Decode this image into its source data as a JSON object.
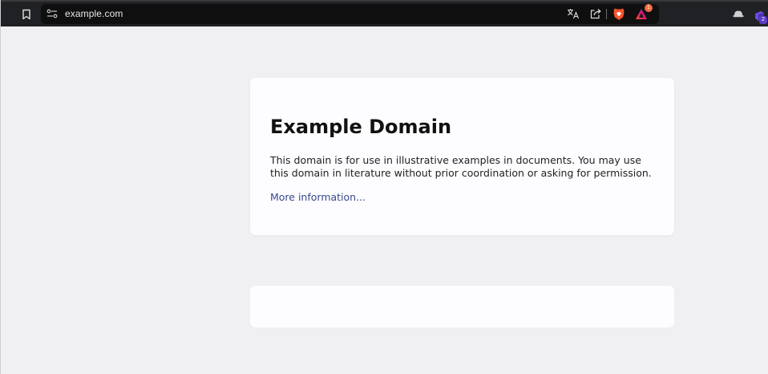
{
  "browser": {
    "url": "example.com",
    "rewards_badge_count": "1",
    "wallet_badge_count": "2",
    "icons": [
      "bookmark-icon",
      "site-settings-icon",
      "translate-icon",
      "share-icon",
      "brave-shield-icon",
      "brave-rewards-icon",
      "profile-icon",
      "wallet-icon"
    ]
  },
  "page": {
    "title": "Example Domain",
    "paragraph": "This domain is for use in illustrative examples in documents. You may use this domain in literature without prior coordination or asking for permission.",
    "link_text": "More information..."
  },
  "colors": {
    "toolbar": "#202124",
    "omnibox": "#0f0f10",
    "page_background": "#f0f0f2",
    "card_background": "#fdfdff",
    "link": "#38488f",
    "shield_orange": "#fb542b",
    "rewards_badge": "#f26a3d",
    "wallet_badge": "#5b3cc4"
  }
}
